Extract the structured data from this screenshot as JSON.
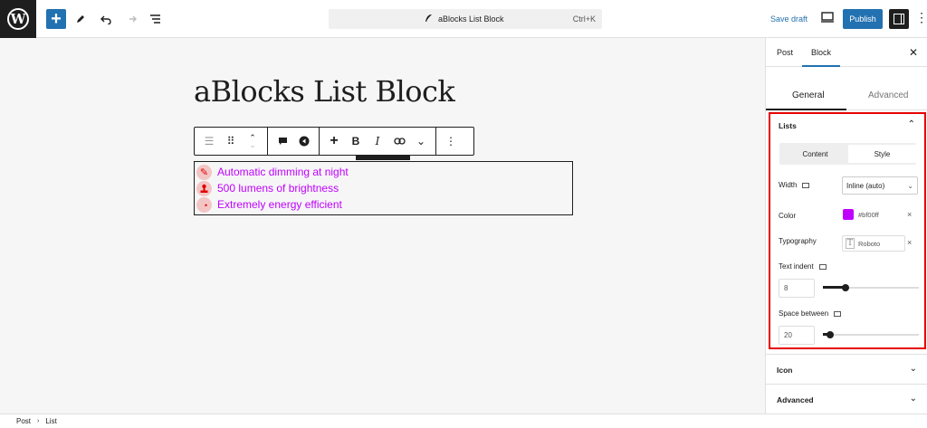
{
  "topbar": {
    "logo": "W",
    "add_label": "+",
    "doc_title": "aBlocks List Block",
    "shortcut": "Ctrl+K",
    "save_draft": "Save draft",
    "publish": "Publish"
  },
  "editor": {
    "title": "aBlocks List Block",
    "list_items": [
      {
        "text": "Automatic dimming at night",
        "icon": "pencil-icon"
      },
      {
        "text": "500 lumens of brightness",
        "icon": "stamp-icon"
      },
      {
        "text": "Extremely energy efficient",
        "icon": "crescent-icon"
      }
    ],
    "list_color": "#bf00ff"
  },
  "sidebar": {
    "tabs": [
      "Post",
      "Block"
    ],
    "active_tab": "Block",
    "subtabs": [
      "General",
      "Advanced"
    ],
    "active_subtab": "General",
    "lists_panel": {
      "title": "Lists",
      "segments": [
        "Content",
        "Style"
      ],
      "active_segment": "Style",
      "width_label": "Width",
      "width_value": "Inline (auto)",
      "color_label": "Color",
      "color_value": "#bf00ff",
      "typography_label": "Typography",
      "typography_value": "Roboto",
      "text_indent_label": "Text indent",
      "text_indent_value": "8",
      "text_indent_fraction": 0.16,
      "space_between_label": "Space between",
      "space_between_value": "20",
      "space_between_fraction": 0.0
    },
    "sections": [
      "Icon",
      "Advanced"
    ]
  },
  "footer": {
    "breadcrumb": [
      "Post",
      "List"
    ]
  }
}
